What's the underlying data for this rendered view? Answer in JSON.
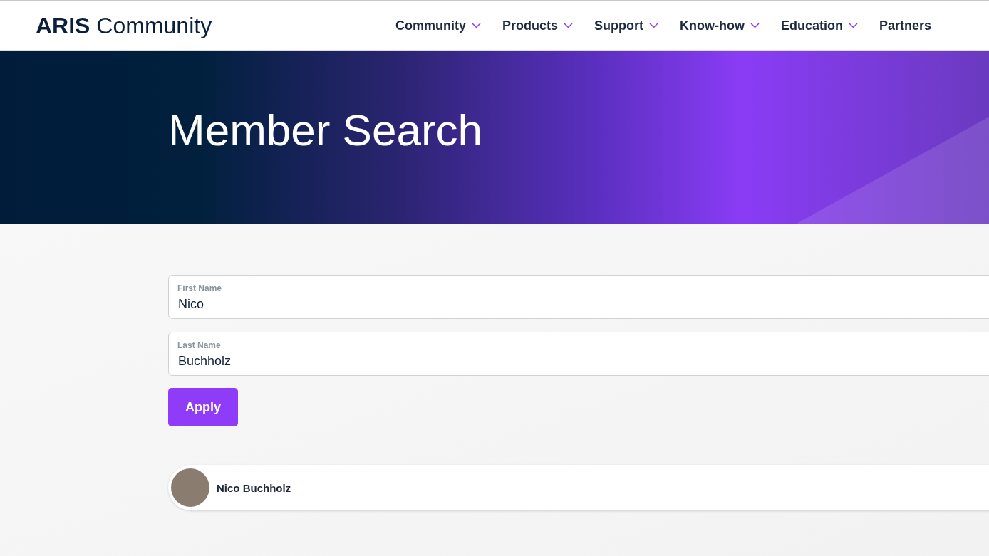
{
  "header": {
    "logo": "**ARIS** Community",
    "nav": [
      {
        "label": "Community",
        "has_menu": true
      },
      {
        "label": "Products",
        "has_menu": true
      },
      {
        "label": "Support",
        "has_menu": true
      },
      {
        "label": "Know-how",
        "has_menu": true
      },
      {
        "label": "Education",
        "has_menu": true
      },
      {
        "label": "Partners",
        "has_menu": false
      }
    ]
  },
  "hero": {
    "title": "Member Search"
  },
  "form": {
    "fields": [
      {
        "label": "First Name",
        "value": "Nico"
      },
      {
        "label": "Last Name",
        "value": "Buchholz"
      }
    ],
    "button": "Apply"
  },
  "results": [
    {
      "name": "Nico Buchholz"
    }
  ]
}
